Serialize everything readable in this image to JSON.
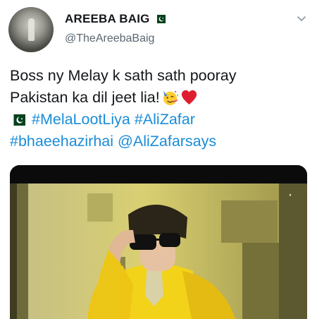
{
  "header": {
    "display_name": "AREEBA BAIG",
    "handle": "@TheAreebaBaig",
    "flag_icon": "pakistan-flag-icon",
    "menu_icon": "chevron-down-icon"
  },
  "tweet": {
    "line1": "Boss ny Melay k sath sath pooray",
    "line2": "Pakistan ka dil jeet lia!",
    "line2_emojis": [
      "partying-face-emoji",
      "red-heart-emoji"
    ],
    "line3_flag": "pakistan-flag-icon",
    "hashtags": [
      "#MelaLootLiya",
      "#AliZafar",
      "#bhaeehazirhai"
    ],
    "mention": "@AliZafarsays"
  },
  "media": {
    "type": "video-still",
    "description_icon": "video-frame",
    "colors": {
      "jacket": "#f3d21a",
      "background": "#cdbf5a",
      "shadow": "#2b2a12"
    }
  },
  "colors": {
    "link": "#1b8cd8",
    "text": "#14171a",
    "secondary": "#5b6770"
  }
}
